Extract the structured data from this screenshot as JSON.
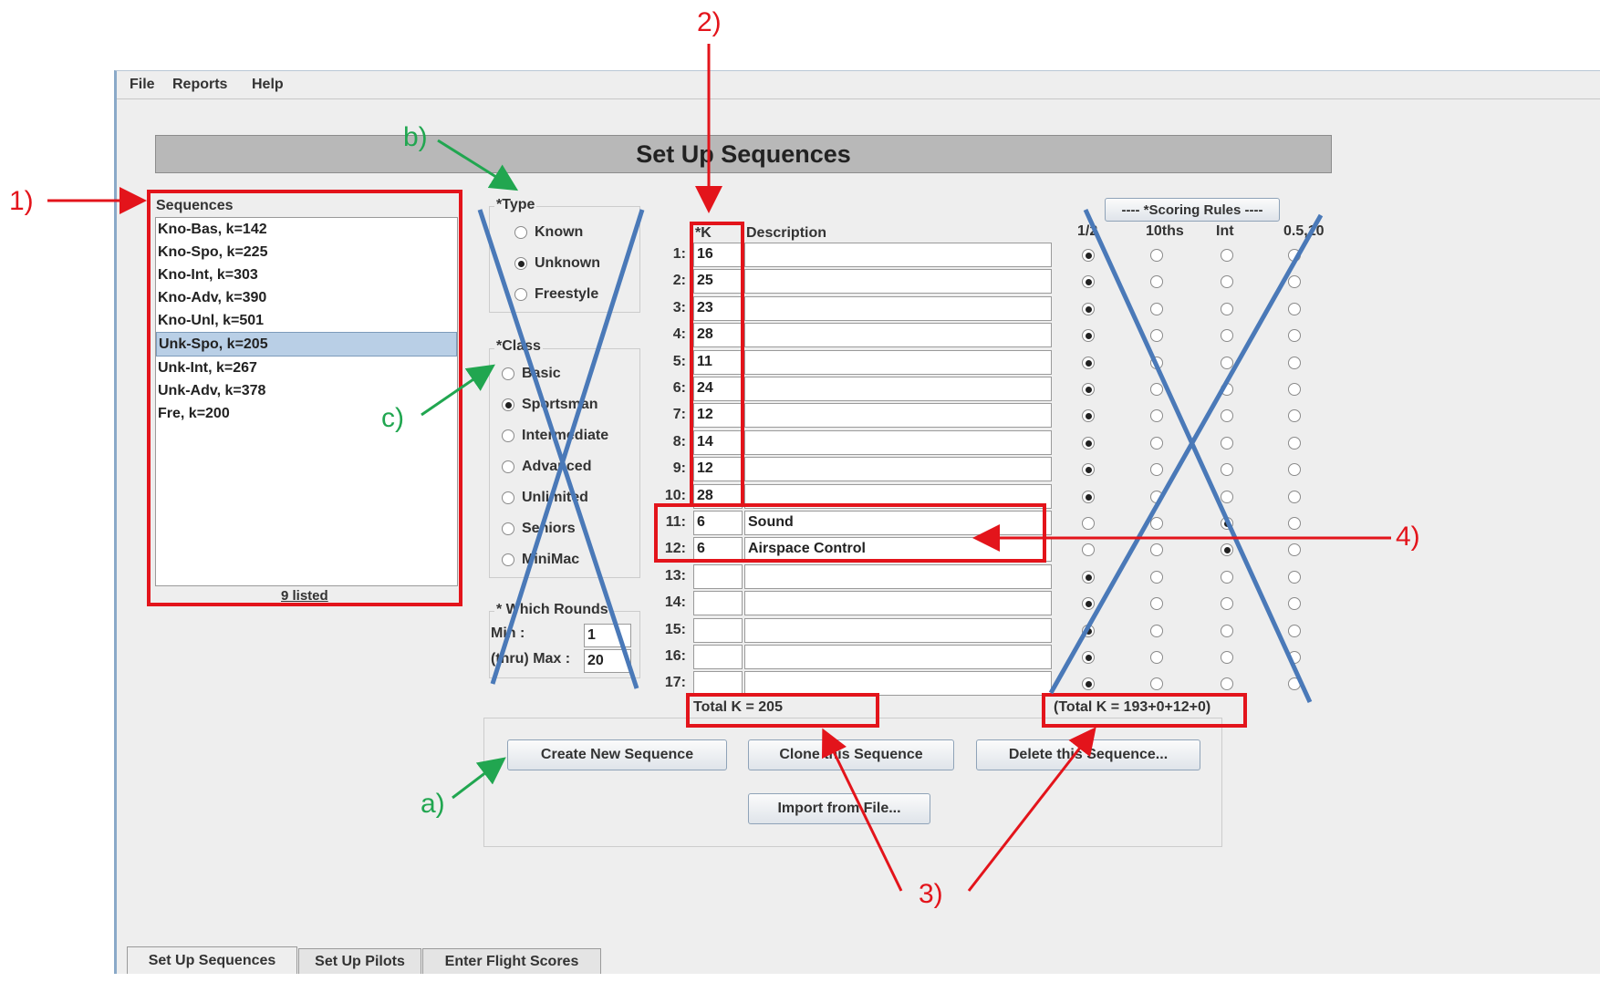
{
  "menu": [
    "File",
    "Reports",
    "Help"
  ],
  "page_title": "Set Up Sequences",
  "sequences": {
    "header": "Sequences",
    "items": [
      "Kno-Bas, k=142",
      "Kno-Spo, k=225",
      "Kno-Int, k=303",
      "Kno-Adv, k=390",
      "Kno-Unl, k=501",
      "Unk-Spo, k=205",
      "Unk-Int, k=267",
      "Unk-Adv, k=378",
      "Fre, k=200"
    ],
    "selected_index": 5,
    "count_label": "9 listed"
  },
  "type_group": {
    "label": "*Type",
    "options": [
      "Known",
      "Unknown",
      "Freestyle"
    ],
    "selected": "Unknown"
  },
  "class_group": {
    "label": "*Class",
    "options": [
      "Basic",
      "Sportsman",
      "Intermediate",
      "Advanced",
      "Unlimited",
      "Seniors",
      "MiniMac"
    ],
    "selected": "Sportsman"
  },
  "rounds": {
    "label": "* Which Rounds",
    "min_label": "Min :",
    "min_value": "1",
    "max_label": "(thru) Max :",
    "max_value": "20"
  },
  "table": {
    "k_header": "*K",
    "desc_header": "Description",
    "scoring_header": "---- *Scoring Rules ----",
    "scoring_columns": [
      "1/2",
      "10ths",
      "Int",
      "0.5,10"
    ],
    "rows": [
      {
        "num": "1:",
        "k": "16",
        "desc": "",
        "rule": 0
      },
      {
        "num": "2:",
        "k": "25",
        "desc": "",
        "rule": 0
      },
      {
        "num": "3:",
        "k": "23",
        "desc": "",
        "rule": 0
      },
      {
        "num": "4:",
        "k": "28",
        "desc": "",
        "rule": 0
      },
      {
        "num": "5:",
        "k": "11",
        "desc": "",
        "rule": 0
      },
      {
        "num": "6:",
        "k": "24",
        "desc": "",
        "rule": 0
      },
      {
        "num": "7:",
        "k": "12",
        "desc": "",
        "rule": 0
      },
      {
        "num": "8:",
        "k": "14",
        "desc": "",
        "rule": 0
      },
      {
        "num": "9:",
        "k": "12",
        "desc": "",
        "rule": 0
      },
      {
        "num": "10:",
        "k": "28",
        "desc": "",
        "rule": 0
      },
      {
        "num": "11:",
        "k": "6",
        "desc": "Sound",
        "rule": 2
      },
      {
        "num": "12:",
        "k": "6",
        "desc": "Airspace Control",
        "rule": 2
      },
      {
        "num": "13:",
        "k": "",
        "desc": "",
        "rule": 0
      },
      {
        "num": "14:",
        "k": "",
        "desc": "",
        "rule": 0
      },
      {
        "num": "15:",
        "k": "",
        "desc": "",
        "rule": 0
      },
      {
        "num": "16:",
        "k": "",
        "desc": "",
        "rule": 0
      },
      {
        "num": "17:",
        "k": "",
        "desc": "",
        "rule": 0
      }
    ],
    "total_k": "Total K = 205",
    "total_breakdown": "(Total K = 193+0+12+0)"
  },
  "buttons": {
    "create": "Create New Sequence",
    "clone": "Clone this Sequence",
    "delete": "Delete this Sequence...",
    "import": "Import from File..."
  },
  "tabs": [
    "Set Up Sequences",
    "Set Up Pilots",
    "Enter Flight Scores"
  ],
  "annotations": {
    "n1": "1)",
    "n2": "2)",
    "n3": "3)",
    "n4": "4)",
    "a": "a)",
    "b": "b)",
    "c": "c)"
  },
  "colors": {
    "red_annotation": "#e3141b",
    "green_annotation": "#21a650",
    "blue_cross": "#4a79b8"
  }
}
